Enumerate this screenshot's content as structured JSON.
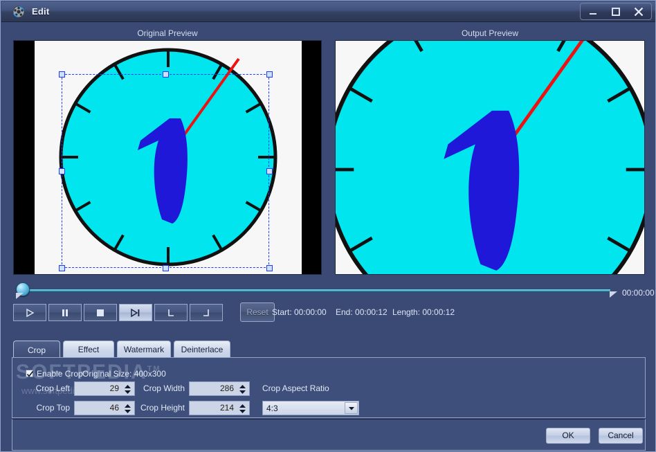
{
  "window": {
    "title": "Edit",
    "app_icon": "film-reel-icon",
    "controls": {
      "minimize": "minimize-icon",
      "maximize": "maximize-icon",
      "close": "close-icon"
    }
  },
  "previews": {
    "original_label": "Original Preview",
    "output_label": "Output Preview"
  },
  "seek": {
    "current_time": "00:00:00",
    "position_percent": 0
  },
  "transport": {
    "buttons": [
      {
        "name": "play-button",
        "icon": "play-icon",
        "state": "normal"
      },
      {
        "name": "pause-button",
        "icon": "pause-icon",
        "state": "normal"
      },
      {
        "name": "stop-button",
        "icon": "stop-icon",
        "state": "normal"
      },
      {
        "name": "next-frame-button",
        "icon": "next-frame-icon",
        "state": "highlighted"
      },
      {
        "name": "set-start-button",
        "icon": "mark-in-icon",
        "state": "normal"
      },
      {
        "name": "set-end-button",
        "icon": "mark-out-icon",
        "state": "normal"
      }
    ],
    "reset_label": "Reset",
    "start_text": "Start: 00:00:00",
    "end_text": "End: 00:00:12",
    "length_text": "Length: 00:00:12"
  },
  "tabs": [
    {
      "label": "Crop",
      "active": true
    },
    {
      "label": "Effect",
      "active": false
    },
    {
      "label": "Watermark",
      "active": false
    },
    {
      "label": "Deinterlace",
      "active": false
    }
  ],
  "crop": {
    "enable_label": "Enable Crop",
    "enable_checked": true,
    "original_size_label": "Original Size: 400x300",
    "fields": [
      {
        "label": "Crop Left",
        "value": "29"
      },
      {
        "label": "Crop Top",
        "value": "46"
      },
      {
        "label": "Crop Width",
        "value": "286"
      },
      {
        "label": "Crop Height",
        "value": "214"
      }
    ],
    "aspect_ratio_label": "Crop Aspect Ratio",
    "aspect_ratio_value": "4:3"
  },
  "watermark": {
    "brand": "SOFTPEDIA",
    "trademark": "TM",
    "url": "www.softpedia.com"
  },
  "footer": {
    "ok_label": "OK",
    "cancel_label": "Cancel"
  },
  "colors": {
    "window_bg": "#3a4a75",
    "panel_bg": "#3f4f7c",
    "titlebar_top": "#4f618d",
    "clock_face": "#00e5ee",
    "clock_hand": "#1f18d8",
    "second_hand": "#ee1111",
    "marquee": "#1b3bff"
  }
}
